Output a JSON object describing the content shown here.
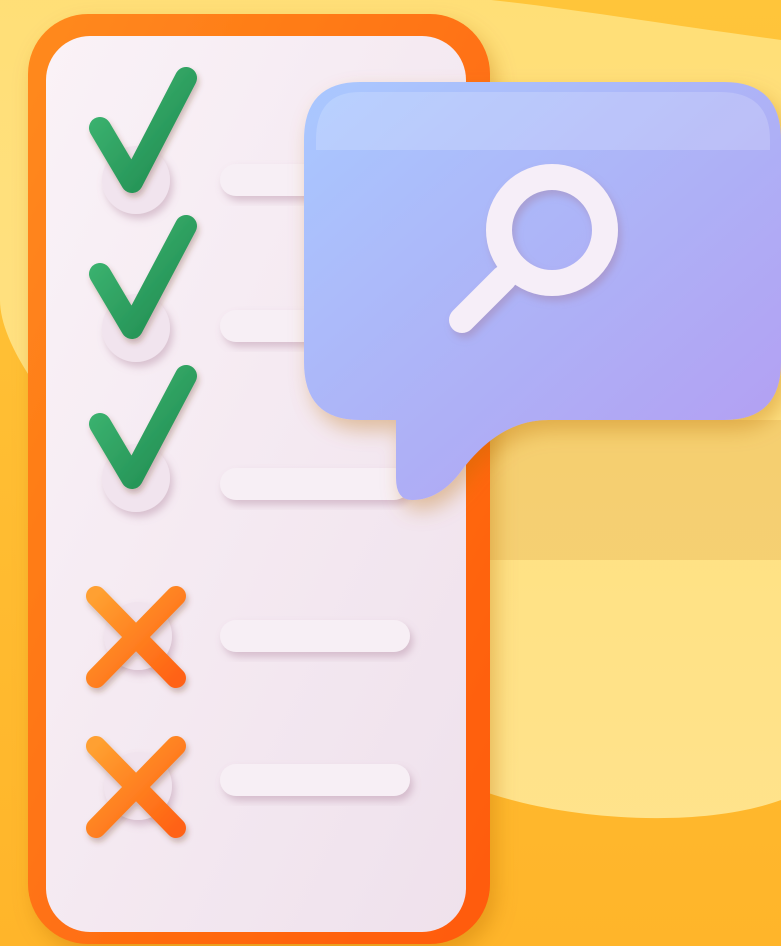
{
  "illustration": {
    "checklist_items": [
      {
        "status": "checked",
        "mark_icon": "checkmark-icon",
        "mark_color": "#2a9d5e"
      },
      {
        "status": "checked",
        "mark_icon": "checkmark-icon",
        "mark_color": "#2a9d5e"
      },
      {
        "status": "checked",
        "mark_icon": "checkmark-icon",
        "mark_color": "#2a9d5e"
      },
      {
        "status": "crossed",
        "mark_icon": "cross-icon",
        "mark_color": "#ff7a1a"
      },
      {
        "status": "crossed",
        "mark_icon": "cross-icon",
        "mark_color": "#ff7a1a"
      }
    ],
    "search_bubble": {
      "icon": "magnifying-glass-icon",
      "color": "#a6aaf5"
    },
    "colors": {
      "background": "#ffc43a",
      "board_frame": "#ff6a0d",
      "board_surface": "#f5eaf2",
      "check": "#2a9d5e",
      "cross": "#ff7a1a",
      "bubble": "#a6aaf5"
    }
  }
}
